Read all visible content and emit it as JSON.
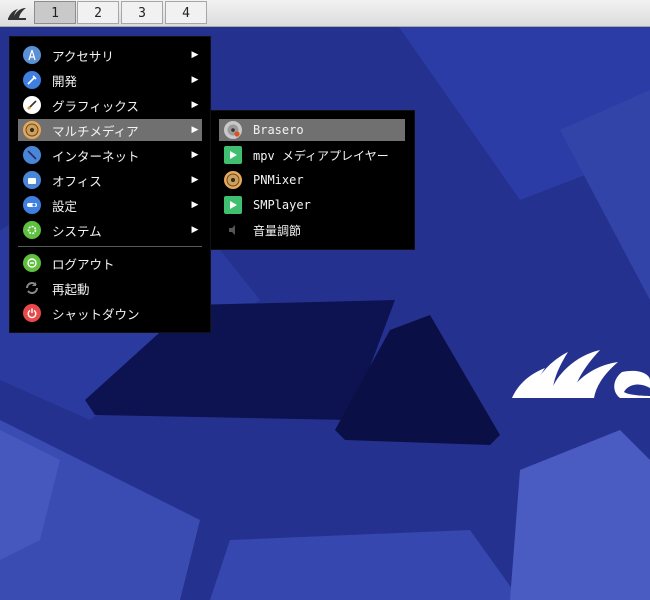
{
  "panel": {
    "workspaces": [
      "1",
      "2",
      "3",
      "4"
    ],
    "active_workspace": "1",
    "menu_icon": "menu-logo-icon"
  },
  "main_menu": {
    "items": [
      {
        "label": "アクセサリ",
        "icon": "accessories-icon",
        "color": "#5b8fd6",
        "submenu": true
      },
      {
        "label": "開発",
        "icon": "development-icon",
        "color": "#3f7fe0",
        "submenu": true
      },
      {
        "label": "グラフィックス",
        "icon": "graphics-icon",
        "color": "#ffffff",
        "submenu": true
      },
      {
        "label": "マルチメディア",
        "icon": "multimedia-icon",
        "color": "#e8a75a",
        "submenu": true,
        "selected": true
      },
      {
        "label": "インターネット",
        "icon": "internet-icon",
        "color": "#4a86d8",
        "submenu": true
      },
      {
        "label": "オフィス",
        "icon": "office-icon",
        "color": "#4a86d8",
        "submenu": true
      },
      {
        "label": "設定",
        "icon": "settings-icon",
        "color": "#3f7fe0",
        "submenu": true
      },
      {
        "label": "システム",
        "icon": "system-icon",
        "color": "#5fbf3f",
        "submenu": true
      }
    ],
    "actions": [
      {
        "label": "ログアウト",
        "icon": "logout-icon",
        "color": "#5fbf3f"
      },
      {
        "label": "再起動",
        "icon": "reboot-icon",
        "color": "#8a8a8a"
      },
      {
        "label": "シャットダウン",
        "icon": "shutdown-icon",
        "color": "#e84a4a"
      }
    ]
  },
  "multimedia_submenu": {
    "items": [
      {
        "label": "Brasero",
        "icon": "brasero-icon",
        "selected": true
      },
      {
        "label": "mpv メディアプレイヤー",
        "icon": "mpv-icon"
      },
      {
        "label": "PNMixer",
        "icon": "pnmixer-icon"
      },
      {
        "label": "SMPlayer",
        "icon": "smplayer-icon"
      },
      {
        "label": "音量調節",
        "icon": "volume-control-icon"
      }
    ]
  },
  "colors": {
    "desktop_bg": "#25318f",
    "menu_bg": "#000000",
    "selection": "#707070",
    "panel_bg": "#e6e6e6"
  }
}
